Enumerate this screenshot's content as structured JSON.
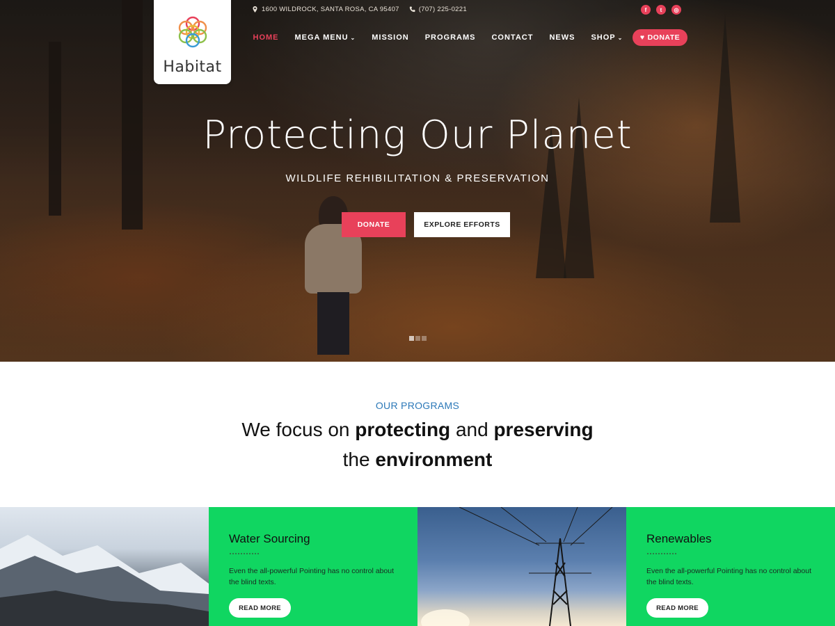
{
  "brand": {
    "name": "Habitat"
  },
  "topbar": {
    "address": "1600 WILDROCK, SANTA ROSA, CA 95407",
    "phone": "(707) 225-0221",
    "socials": [
      {
        "icon": "facebook-icon",
        "glyph": "f"
      },
      {
        "icon": "twitter-icon",
        "glyph": "t"
      },
      {
        "icon": "instagram-icon",
        "glyph": "◎"
      }
    ]
  },
  "nav": {
    "items": [
      {
        "label": "HOME",
        "active": true
      },
      {
        "label": "MEGA MENU",
        "dropdown": true
      },
      {
        "label": "MISSION"
      },
      {
        "label": "PROGRAMS"
      },
      {
        "label": "CONTACT"
      },
      {
        "label": "NEWS"
      },
      {
        "label": "SHOP",
        "dropdown": true
      }
    ],
    "donate_label": "DONATE",
    "caret": "⌄",
    "heart": "♥"
  },
  "hero": {
    "title": "Protecting Our Planet",
    "subtitle": "WILDLIFE REHIBILITATION & PRESERVATION",
    "donate_label": "DONATE",
    "explore_label": "EXPLORE EFFORTS",
    "slides": 3,
    "active_slide": 1
  },
  "programs": {
    "eyebrow": "OUR PROGRAMS",
    "line1_pre": "We focus on ",
    "line1_b1": "protecting",
    "line1_mid": " and ",
    "line1_b2": "preserving",
    "line2_pre": "the ",
    "line2_b": "environment"
  },
  "cards": [
    {
      "type": "image",
      "image": "snowy-mountains"
    },
    {
      "type": "text",
      "title": "Water Sourcing",
      "text": "Even the all-powerful Pointing has no control about the blind texts.",
      "button": "READ MORE"
    },
    {
      "type": "image",
      "image": "power-line-tower"
    },
    {
      "type": "text",
      "title": "Renewables",
      "text": "Even the all-powerful Pointing has no control about the blind texts.",
      "button": "READ MORE"
    }
  ],
  "colors": {
    "accent": "#e8415a",
    "eyebrow": "#2b78b8",
    "card_green": "#10d661"
  }
}
